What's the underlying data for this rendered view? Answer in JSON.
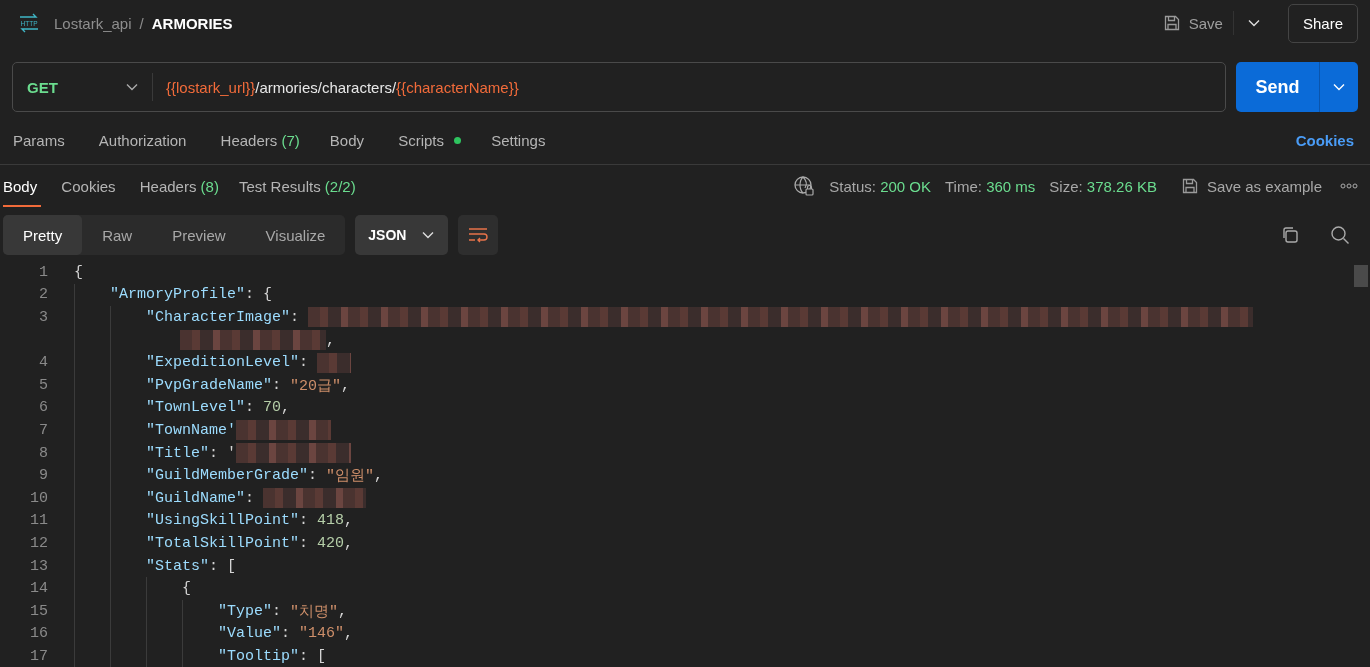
{
  "app_icon_text": "HTTP",
  "breadcrumb": {
    "collection": "Lostark_api",
    "separator": "/",
    "request": "ARMORIES"
  },
  "header_actions": {
    "save": "Save",
    "share": "Share"
  },
  "request": {
    "method": "GET",
    "url": [
      {
        "kind": "var",
        "text": "{{lostark_url}}"
      },
      {
        "kind": "plain",
        "text": "/armories/characters/"
      },
      {
        "kind": "var",
        "text": "{{characterName}}"
      }
    ],
    "send": "Send"
  },
  "request_tabs": [
    {
      "label": "Params",
      "dot": false,
      "selected": false
    },
    {
      "label": "Authorization",
      "dot": false,
      "selected": false
    },
    {
      "label": "Headers",
      "count": "(7)",
      "dot": false,
      "selected": false
    },
    {
      "label": "Body",
      "dot": false,
      "selected": false
    },
    {
      "label": "Scripts",
      "dot": true,
      "selected": false
    },
    {
      "label": "Settings",
      "dot": false,
      "selected": false
    }
  ],
  "cookies_link": "Cookies",
  "response_tabs": [
    {
      "label": "Body",
      "selected": true
    },
    {
      "label": "Cookies",
      "selected": false
    },
    {
      "label": "Headers",
      "count": "(8)",
      "selected": false
    },
    {
      "label": "Test Results",
      "count": "(2/2)",
      "selected": false
    }
  ],
  "response_meta": [
    {
      "label": "Status:",
      "value": "200 OK"
    },
    {
      "label": "Time:",
      "value": "360 ms"
    },
    {
      "label": "Size:",
      "value": "378.26 KB"
    }
  ],
  "save_example": "Save as example",
  "view_modes": [
    {
      "label": "Pretty",
      "selected": true
    },
    {
      "label": "Raw",
      "selected": false
    },
    {
      "label": "Preview",
      "selected": false
    },
    {
      "label": "Visualize",
      "selected": false
    }
  ],
  "format": "JSON",
  "code_lines": [
    {
      "number": "1",
      "tokens": [
        {
          "kind": "open",
          "text": "{"
        }
      ]
    },
    {
      "number": "2",
      "tokens": [
        {
          "kind": "key",
          "text": "\"ArmoryProfile\""
        },
        {
          "kind": "punct",
          "text": ": "
        },
        {
          "kind": "open",
          "text": "{"
        }
      ]
    },
    {
      "number": "3",
      "tokens": [
        {
          "kind": "key",
          "text": "\"CharacterImage\""
        },
        {
          "kind": "punct",
          "text": ": "
        },
        {
          "kind": "redacted"
        }
      ],
      "continuation": [
        {
          "kind": "redacted"
        },
        {
          "kind": "punct",
          "text": ","
        }
      ]
    },
    {
      "number": "4",
      "tokens": [
        {
          "kind": "key",
          "text": "\"ExpeditionLevel\""
        },
        {
          "kind": "punct",
          "text": ": "
        },
        {
          "kind": "redacted"
        }
      ]
    },
    {
      "number": "5",
      "tokens": [
        {
          "kind": "key",
          "text": "\"PvpGradeName\""
        },
        {
          "kind": "punct",
          "text": ": "
        },
        {
          "kind": "string",
          "text": "\"20급\""
        },
        {
          "kind": "punct",
          "text": ","
        }
      ]
    },
    {
      "number": "6",
      "tokens": [
        {
          "kind": "key",
          "text": "\"TownLevel\""
        },
        {
          "kind": "punct",
          "text": ": "
        },
        {
          "kind": "number",
          "text": "70"
        },
        {
          "kind": "punct",
          "text": ","
        }
      ]
    },
    {
      "number": "7",
      "tokens": [
        {
          "kind": "key",
          "text": "\"TownName'"
        },
        {
          "kind": "redacted"
        }
      ]
    },
    {
      "number": "8",
      "tokens": [
        {
          "kind": "key",
          "text": "\"Title\""
        },
        {
          "kind": "punct",
          "text": ": '"
        },
        {
          "kind": "redacted"
        }
      ]
    },
    {
      "number": "9",
      "tokens": [
        {
          "kind": "key",
          "text": "\"GuildMemberGrade\""
        },
        {
          "kind": "punct",
          "text": ": "
        },
        {
          "kind": "string",
          "text": "\"임원\""
        },
        {
          "kind": "punct",
          "text": ","
        }
      ]
    },
    {
      "number": "10",
      "tokens": [
        {
          "kind": "key",
          "text": "\"GuildName\""
        },
        {
          "kind": "punct",
          "text": ": "
        },
        {
          "kind": "redacted"
        }
      ]
    },
    {
      "number": "11",
      "tokens": [
        {
          "kind": "key",
          "text": "\"UsingSkillPoint\""
        },
        {
          "kind": "punct",
          "text": ": "
        },
        {
          "kind": "number",
          "text": "418"
        },
        {
          "kind": "punct",
          "text": ","
        }
      ]
    },
    {
      "number": "12",
      "tokens": [
        {
          "kind": "key",
          "text": "\"TotalSkillPoint\""
        },
        {
          "kind": "punct",
          "text": ": "
        },
        {
          "kind": "number",
          "text": "420"
        },
        {
          "kind": "punct",
          "text": ","
        }
      ]
    },
    {
      "number": "13",
      "tokens": [
        {
          "kind": "key",
          "text": "\"Stats\""
        },
        {
          "kind": "punct",
          "text": ": "
        },
        {
          "kind": "open",
          "text": "["
        }
      ]
    },
    {
      "number": "14",
      "tokens": [
        {
          "kind": "open",
          "text": "{"
        }
      ]
    },
    {
      "number": "15",
      "tokens": [
        {
          "kind": "key",
          "text": "\"Type\""
        },
        {
          "kind": "punct",
          "text": ": "
        },
        {
          "kind": "string",
          "text": "\"치명\""
        },
        {
          "kind": "punct",
          "text": ","
        }
      ]
    },
    {
      "number": "16",
      "tokens": [
        {
          "kind": "key",
          "text": "\"Value\""
        },
        {
          "kind": "punct",
          "text": ": "
        },
        {
          "kind": "string",
          "text": "\"146\""
        },
        {
          "kind": "punct",
          "text": ","
        }
      ]
    },
    {
      "number": "17",
      "tokens": [
        {
          "kind": "key",
          "text": "\"Tooltip\""
        },
        {
          "kind": "punct",
          "text": ": "
        },
        {
          "kind": "open",
          "text": "["
        }
      ]
    }
  ]
}
